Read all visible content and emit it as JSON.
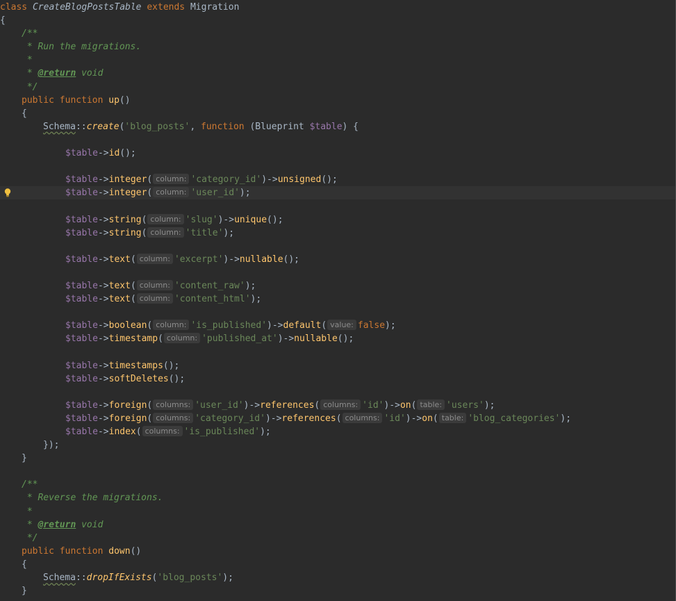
{
  "colors": {
    "background": "#2b2b2b",
    "highlight_line": "#323232",
    "keyword": "#cc7832",
    "function": "#ffc66d",
    "variable": "#9876aa",
    "string": "#6a8759",
    "comment": "#629755",
    "default_text": "#a9b7c6",
    "hint_bg": "#3b3b3b",
    "hint_text": "#8c8c8c"
  },
  "gutter": {
    "icon": "lightbulb-icon",
    "icon_color": "#f0c040"
  },
  "code": {
    "class_kw": "class",
    "class_name": "CreateBlogPostsTable",
    "extends_kw": "extends",
    "parent_class": "Migration",
    "open_brace": "{",
    "close_brace": "}",
    "up_doc": {
      "open": "/**",
      "summary": " * Run the migrations.",
      "blank": " *",
      "return_prefix": " * ",
      "return_tag": "@return",
      "return_type": " void",
      "close": " */"
    },
    "public_kw": "public",
    "function_kw": "function",
    "up_name": "up",
    "parens": "()",
    "schema_class": "Schema",
    "scope_op": "::",
    "create_method": "create",
    "table_name": "'blog_posts'",
    "closure_function_kw": "function",
    "blueprint_type": "Blueprint",
    "table_var": "$table",
    "arrow": "->",
    "hints": {
      "column": "column:",
      "columns": "columns:",
      "value": "value:",
      "table": "table:"
    },
    "methods": {
      "id": "id",
      "integer": "integer",
      "unsigned": "unsigned",
      "string": "string",
      "unique": "unique",
      "text": "text",
      "nullable": "nullable",
      "boolean": "boolean",
      "default": "default",
      "timestamp": "timestamp",
      "timestamps": "timestamps",
      "softDeletes": "softDeletes",
      "foreign": "foreign",
      "references": "references",
      "on": "on",
      "index": "index"
    },
    "strings": {
      "category_id": "'category_id'",
      "user_id": "'user_id'",
      "slug": "'slug'",
      "title": "'title'",
      "excerpt": "'excerpt'",
      "content_raw": "'content_raw'",
      "content_html": "'content_html'",
      "is_published": "'is_published'",
      "published_at": "'published_at'",
      "id": "'id'",
      "users": "'users'",
      "blog_categories": "'blog_categories'"
    },
    "false_kw": "false",
    "closure_close": "});",
    "down_doc": {
      "open": "/**",
      "summary": " * Reverse the migrations.",
      "blank": " *",
      "return_prefix": " * ",
      "return_tag": "@return",
      "return_type": " void",
      "close": " */"
    },
    "down_name": "down",
    "drop_method": "dropIfExists"
  }
}
